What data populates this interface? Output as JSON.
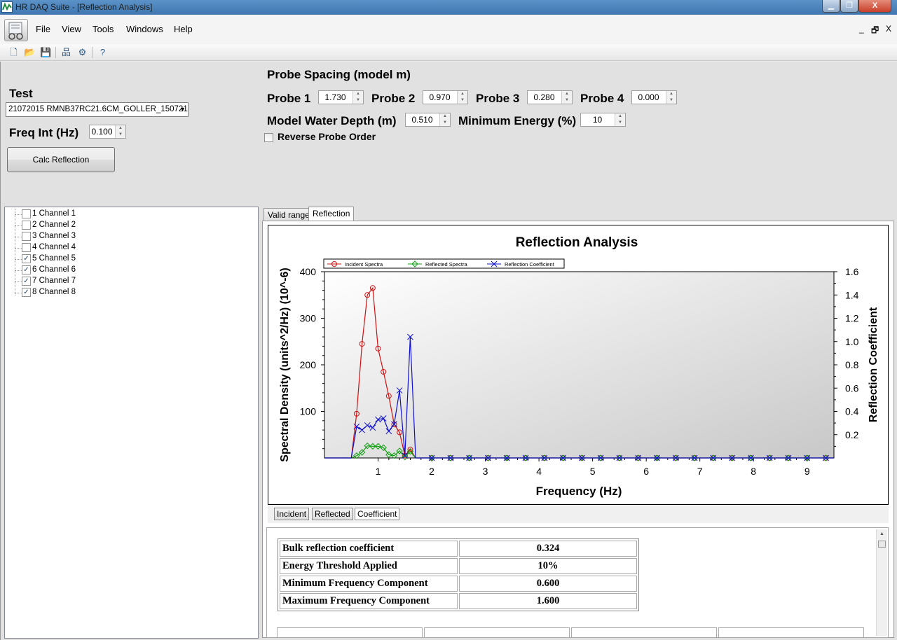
{
  "window": {
    "title": "HR DAQ Suite - [Reflection Analysis]",
    "min_label": "▁",
    "max_label": "❐",
    "close_label": "X"
  },
  "menu": {
    "items": [
      "File",
      "View",
      "Tools",
      "Windows",
      "Help"
    ],
    "mdi_min": "_",
    "mdi_restore": "🗗",
    "mdi_close": "X"
  },
  "toolbar": [
    {
      "name": "new-file-icon",
      "glyph": "🗋"
    },
    {
      "name": "open-folder-icon",
      "glyph": "📂"
    },
    {
      "name": "save-icon",
      "glyph": "💾"
    },
    {
      "name": "network-icon",
      "glyph": "品"
    },
    {
      "name": "settings-gear-icon",
      "glyph": "⚙"
    },
    {
      "name": "help-icon",
      "glyph": "?"
    }
  ],
  "probe_spacing": {
    "title": "Probe Spacing (model m)",
    "probe1": {
      "label": "Probe 1",
      "value": "1.730"
    },
    "probe2": {
      "label": "Probe 2",
      "value": "0.970"
    },
    "probe3": {
      "label": "Probe 3",
      "value": "0.280"
    },
    "probe4": {
      "label": "Probe 4",
      "value": "0.000"
    },
    "water_depth": {
      "label": "Model Water Depth (m)",
      "value": "0.510"
    },
    "min_energy": {
      "label": "Minimum Energy (%)",
      "value": "10"
    },
    "reverse": {
      "label": "Reverse Probe Order",
      "checked": false
    }
  },
  "test": {
    "label": "Test",
    "selected": "21072015 RMNB37RC21.6CM_GOLLER_150721"
  },
  "freq_int": {
    "label": "Freq Int (Hz)",
    "value": "0.100"
  },
  "calc_button": "Calc Reflection",
  "channels": [
    {
      "label": "1 Channel 1",
      "checked": false,
      "mark": ""
    },
    {
      "label": "2 Channel 2",
      "checked": false,
      "mark": ""
    },
    {
      "label": "3 Channel 3",
      "checked": false,
      "mark": ""
    },
    {
      "label": "4 Channel 4",
      "checked": false,
      "mark": ""
    },
    {
      "label": "5 Channel 5",
      "checked": true,
      "mark": "✓"
    },
    {
      "label": "6 Channel 6",
      "checked": true,
      "mark": "✓"
    },
    {
      "label": "7 Channel 7",
      "checked": true,
      "mark": "✓"
    },
    {
      "label": "8 Channel 8",
      "checked": true,
      "mark": "✓"
    }
  ],
  "tabs": [
    "Valid range",
    "Reflection"
  ],
  "active_tab": "Reflection",
  "subtabs": [
    "Incident",
    "Reflected",
    "Coefficient"
  ],
  "stats": [
    {
      "key": "Bulk reflection coefficient",
      "value": "0.324"
    },
    {
      "key": "Energy Threshold Applied",
      "value": "10%"
    },
    {
      "key": "Minimum Frequency Component",
      "value": "0.600"
    },
    {
      "key": "Maximum Frequency Component",
      "value": "1.600"
    }
  ],
  "chart_data": {
    "type": "line",
    "title": "Reflection Analysis",
    "xlabel": "Frequency (Hz)",
    "ylabel": "Spectral Density (units^2/Hz) (10^-6)",
    "y2label": "Reflection Coefficient",
    "xlim": [
      0,
      9.5
    ],
    "ylim": [
      0,
      400
    ],
    "y2lim": [
      0,
      1.6
    ],
    "xticks": [
      1,
      2,
      3,
      4,
      5,
      6,
      7,
      8,
      9
    ],
    "yticks": [
      100,
      200,
      300,
      400
    ],
    "y2ticks": [
      0.2,
      0.4,
      0.6,
      0.8,
      1.0,
      1.2,
      1.4,
      1.6
    ],
    "y2ticklabels": [
      "0.2",
      "0.4",
      "0.6",
      "0.8",
      "1.0",
      "1.2",
      "1.4",
      "1.6"
    ],
    "legend_placement": "top-left",
    "grid": false,
    "series": [
      {
        "name": "Incident Spectra",
        "axis": "left",
        "color": "#d01010",
        "marker": "circle",
        "x": [
          0,
          0.5,
          0.6,
          0.7,
          0.8,
          0.9,
          1.0,
          1.1,
          1.2,
          1.3,
          1.4,
          1.5,
          1.6,
          1.7,
          9.5
        ],
        "y": [
          0,
          0,
          95,
          245,
          350,
          365,
          235,
          185,
          133,
          72,
          55,
          5,
          18,
          0,
          0
        ]
      },
      {
        "name": "Reflected Spectra",
        "axis": "left",
        "color": "#10a010",
        "marker": "diamond",
        "x": [
          0,
          0.5,
          0.6,
          0.7,
          0.8,
          0.9,
          1.0,
          1.1,
          1.2,
          1.3,
          1.4,
          1.5,
          1.6,
          1.7,
          9.5
        ],
        "y": [
          0,
          0,
          5,
          12,
          26,
          25,
          25,
          22,
          7,
          5,
          15,
          2,
          14,
          0,
          0
        ]
      },
      {
        "name": "Reflection Coefficient",
        "axis": "right",
        "color": "#1010d0",
        "marker": "x",
        "x": [
          0,
          0.5,
          0.6,
          0.7,
          0.8,
          0.9,
          1.0,
          1.1,
          1.2,
          1.3,
          1.4,
          1.5,
          1.6,
          1.7,
          9.5
        ],
        "y": [
          0,
          0,
          0.27,
          0.24,
          0.28,
          0.26,
          0.33,
          0.34,
          0.23,
          0.29,
          0.58,
          0.02,
          1.04,
          0,
          0
        ]
      }
    ]
  }
}
